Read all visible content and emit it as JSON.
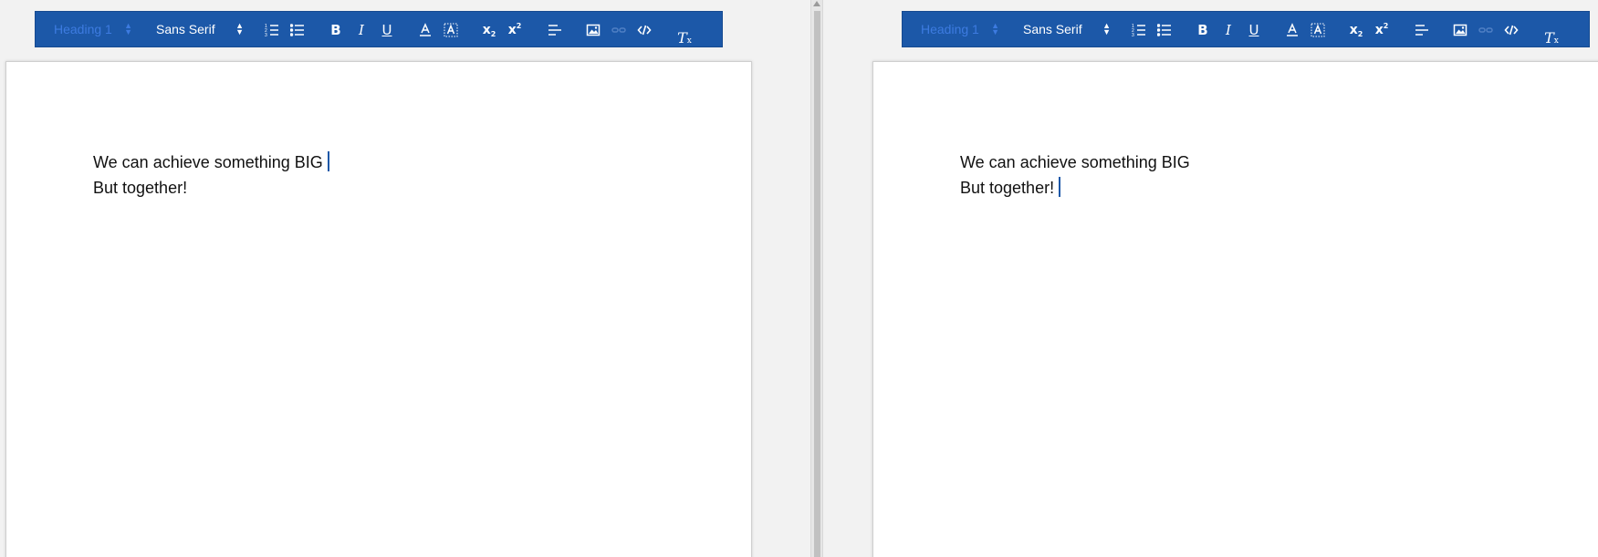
{
  "toolbar": {
    "heading_select": "Heading 1",
    "font_select": "Sans Serif",
    "buttons": {
      "bold": "B",
      "italic": "I",
      "underline": "U",
      "subscript": "x",
      "superscript": "x",
      "sub_mark": "2",
      "sup_mark": "2",
      "clear_format": "T",
      "clear_mark": "x"
    },
    "colors": {
      "background": "#1c58a8",
      "icon": "#ffffff",
      "muted": "#4f7fc4"
    }
  },
  "editors": {
    "left": {
      "lines": [
        "We can achieve something BIG",
        "But together!"
      ],
      "caret_line": 0
    },
    "right": {
      "lines": [
        "We can achieve something BIG",
        "But together!"
      ],
      "caret_line": 1
    }
  },
  "icons": [
    "ordered-list-icon",
    "bullet-list-icon",
    "font-color-icon",
    "highlight-icon",
    "align-left-icon",
    "image-icon",
    "link-icon",
    "code-icon"
  ]
}
